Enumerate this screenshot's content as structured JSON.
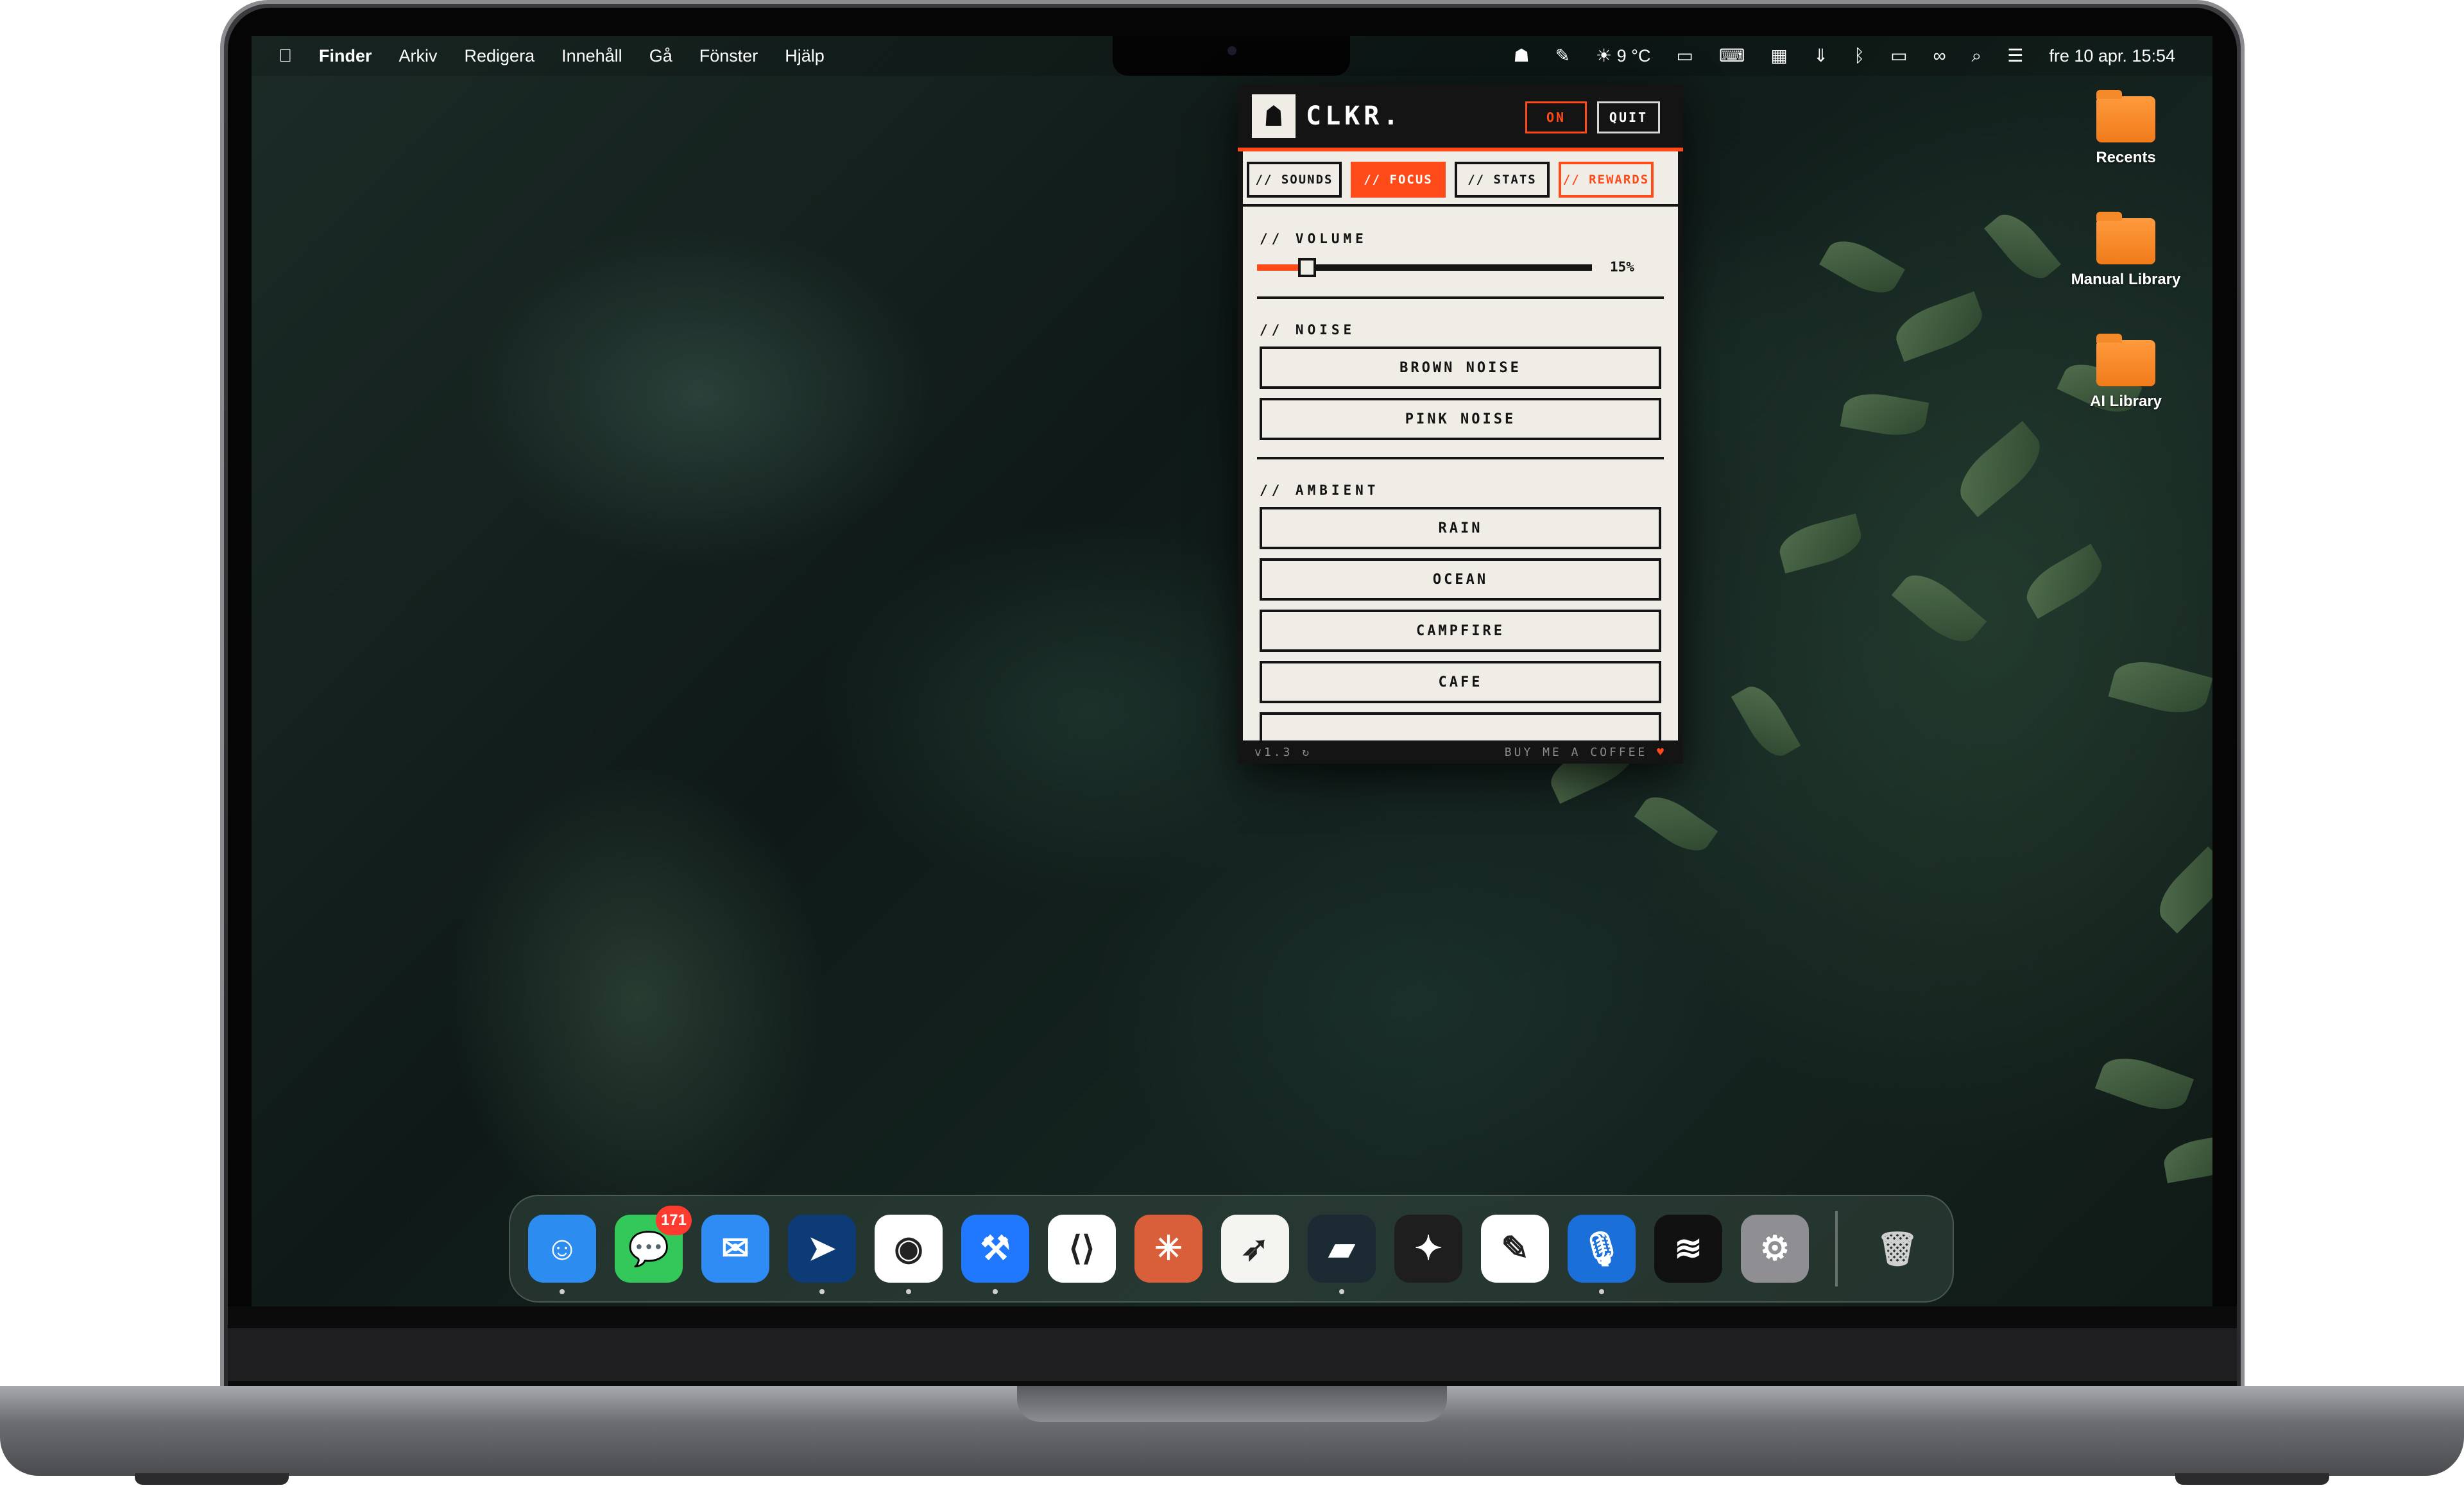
{
  "menubar": {
    "apple_icon": "apple-icon",
    "app_name": "Finder",
    "menus": [
      "Arkiv",
      "Redigera",
      "Innehåll",
      "Gå",
      "Fönster",
      "Hjälp"
    ],
    "weather": "9 °C",
    "clock": "fre 10 apr. 15:54"
  },
  "desktop": {
    "items": [
      {
        "label": "Recents"
      },
      {
        "label": "Manual Library"
      },
      {
        "label": "AI Library"
      }
    ]
  },
  "popup": {
    "app_title": "CLKR.",
    "on_label": "ON",
    "quit_label": "QUIT",
    "tabs": [
      {
        "label": "// SOUNDS"
      },
      {
        "label": "// FOCUS"
      },
      {
        "label": "// STATS"
      },
      {
        "label": "// REWARDS"
      }
    ],
    "volume": {
      "label": "// VOLUME",
      "value_text": "15%",
      "level": 0.15
    },
    "noise": {
      "label": "// NOISE",
      "buttons": [
        "BROWN NOISE",
        "PINK NOISE"
      ]
    },
    "ambient": {
      "label": "// AMBIENT",
      "buttons": [
        "RAIN",
        "OCEAN",
        "CAMPFIRE",
        "CAFE"
      ]
    },
    "footer": {
      "version": "v1.3",
      "coffee": "BUY ME A COFFEE"
    },
    "colors": {
      "accent": "#ff4a1a",
      "panel": "#f0ede6",
      "ink": "#141414"
    }
  },
  "dock": {
    "apps": [
      {
        "name": "finder-icon",
        "glyph": "☺",
        "color": "#2d8cf0"
      },
      {
        "name": "messages-icon",
        "glyph": "💬",
        "color": "#34c759",
        "badge": "171"
      },
      {
        "name": "mail-icon",
        "glyph": "✉",
        "color": "#2f8cf5"
      },
      {
        "name": "navigation-icon",
        "glyph": "➤",
        "color": "#0d3b75"
      },
      {
        "name": "chrome-icon",
        "glyph": "◉",
        "color": "#ffffff"
      },
      {
        "name": "xcode-icon",
        "glyph": "⚒",
        "color": "#1f78ff"
      },
      {
        "name": "vscode-icon",
        "glyph": "⟨⟩",
        "color": "#ffffff"
      },
      {
        "name": "claude-icon",
        "glyph": "✳",
        "color": "#d95f3a"
      },
      {
        "name": "send-icon",
        "glyph": "➶",
        "color": "#f4f4f0"
      },
      {
        "name": "app-icon",
        "glyph": "▰",
        "color": "#1b2a33"
      },
      {
        "name": "figma-icon",
        "glyph": "✦",
        "color": "#1e1e1e"
      },
      {
        "name": "notes-icon",
        "glyph": "✎",
        "color": "#ffffff"
      },
      {
        "name": "voice-icon",
        "glyph": "🎙",
        "color": "#1a6fd8"
      },
      {
        "name": "spotify-icon",
        "glyph": "≋",
        "color": "#111111"
      },
      {
        "name": "settings-icon",
        "glyph": "⚙",
        "color": "#8e8e93"
      }
    ],
    "trash": {
      "name": "trash-icon",
      "glyph": "🗑"
    }
  }
}
